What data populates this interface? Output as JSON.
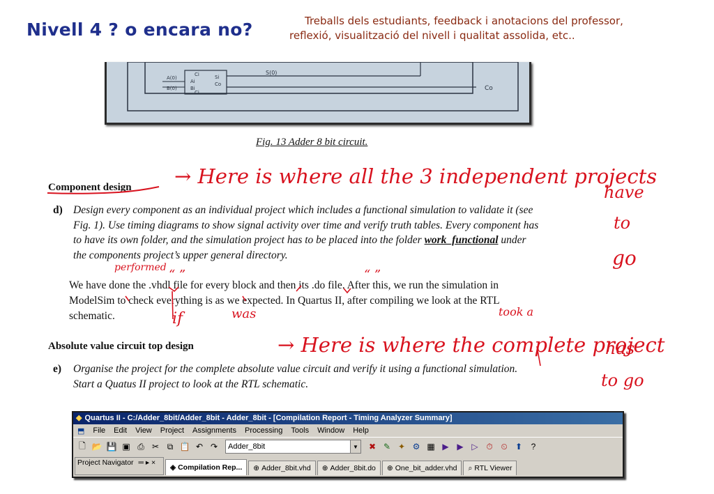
{
  "header": {
    "title": "Nivell 4 ? o encara no?",
    "subtitle_line1": "Treballs dels estudiants, feedback i anotacions del professor,",
    "subtitle_line2": "reflexió, visualització del nivell i qualitat assolida, etc.."
  },
  "photo": {
    "labels": [
      "A(0)",
      "B(0)",
      "Ci",
      "Ai",
      "Bi",
      "Ci",
      "Si",
      "Co",
      "S(0)",
      "Co"
    ]
  },
  "figure_caption": "Fig. 13 Adder 8 bit circuit.",
  "section_component": {
    "heading": "Component design",
    "item_label": "d)",
    "lines": [
      "Design every component as an individual project which includes a functional simulation to validate it (see",
      "Fig. 1). Use timing diagrams to show signal activity over time and verify truth tables. Every component has",
      "to have its own folder, and the simulation project has to be placed into the folder",
      "the components project’s upper general directory."
    ],
    "folder_name": "work_functional",
    "under_word": "under",
    "answer_lines": [
      "We have done the .vhdl file for every block and then its .do file. After this, we run the simulation in",
      "ModelSim to check everything is as we expected. In Quartus II, after compiling we look at the RTL",
      "schematic."
    ]
  },
  "section_absolute": {
    "heading": "Absolute value circuit top design",
    "item_label": "e)",
    "lines": [
      "Organise the project for the complete absolute value circuit and verify it using a functional simulation.",
      "Start a Quatus II project to look at the RTL schematic."
    ]
  },
  "annotations": {
    "note1": "→ Here is where all the 3 independent projects",
    "note1_side": [
      "have",
      "to",
      "go"
    ],
    "performed": "performed",
    "quote_marks": "“ ”",
    "if": "if",
    "was": "was",
    "took_a": "took a",
    "note2": "→ Here is where the complete project",
    "note2_side": [
      "has",
      "to go"
    ]
  },
  "quartus": {
    "window_title": "Quartus II - C:/Adder_8bit/Adder_8bit - Adder_8bit - [Compilation Report - Timing Analyzer Summary]",
    "menu": [
      "File",
      "Edit",
      "View",
      "Project",
      "Assignments",
      "Processing",
      "Tools",
      "Window",
      "Help"
    ],
    "combo_value": "Adder_8bit",
    "project_navigator": "Project Navigator",
    "tabs": [
      "Compilation Rep...",
      "Adder_8bit.vhd",
      "Adder_8bit.do",
      "One_bit_adder.vhd",
      "RTL Viewer"
    ]
  },
  "colors": {
    "title": "#1f2f8c",
    "subtitle": "#8a2a12",
    "ink": "#d8121e"
  }
}
